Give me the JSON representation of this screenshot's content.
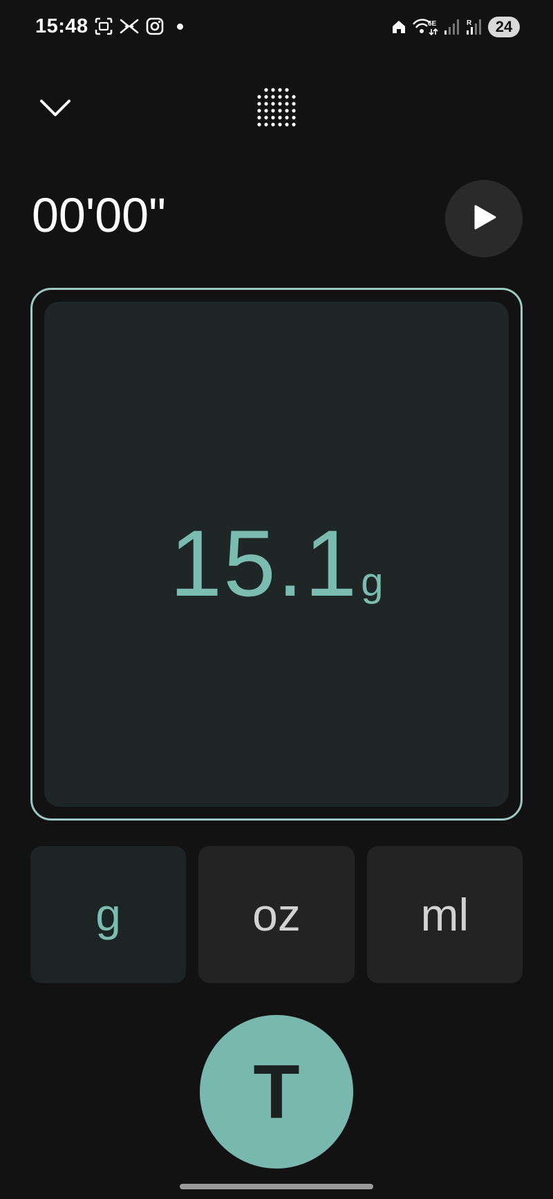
{
  "status_bar": {
    "time": "15:48",
    "left_icons": [
      "screenshot-icon",
      "x-twitter-icon",
      "instagram-icon",
      "notification-dot-icon"
    ],
    "right_icons": [
      "home-icon",
      "wifi-6e-icon",
      "signal-icon",
      "signal-roaming-icon"
    ],
    "battery": "24"
  },
  "top_bar": {
    "back_icon": "chevron-down-icon",
    "grid_icon": "dot-grid-icon"
  },
  "timer": {
    "value": "00'00\"",
    "play_icon": "play-icon"
  },
  "scale": {
    "value": "15.1",
    "unit": "g"
  },
  "units": {
    "options": [
      {
        "label": "g",
        "selected": true
      },
      {
        "label": "oz",
        "selected": false
      },
      {
        "label": "ml",
        "selected": false
      }
    ]
  },
  "tare": {
    "label": "T"
  },
  "colors": {
    "accent": "#78b8ae",
    "accent_text": "#7bbcb1",
    "frame_border": "#9cc9c2",
    "background": "#121212",
    "panel": "#1f2626"
  }
}
